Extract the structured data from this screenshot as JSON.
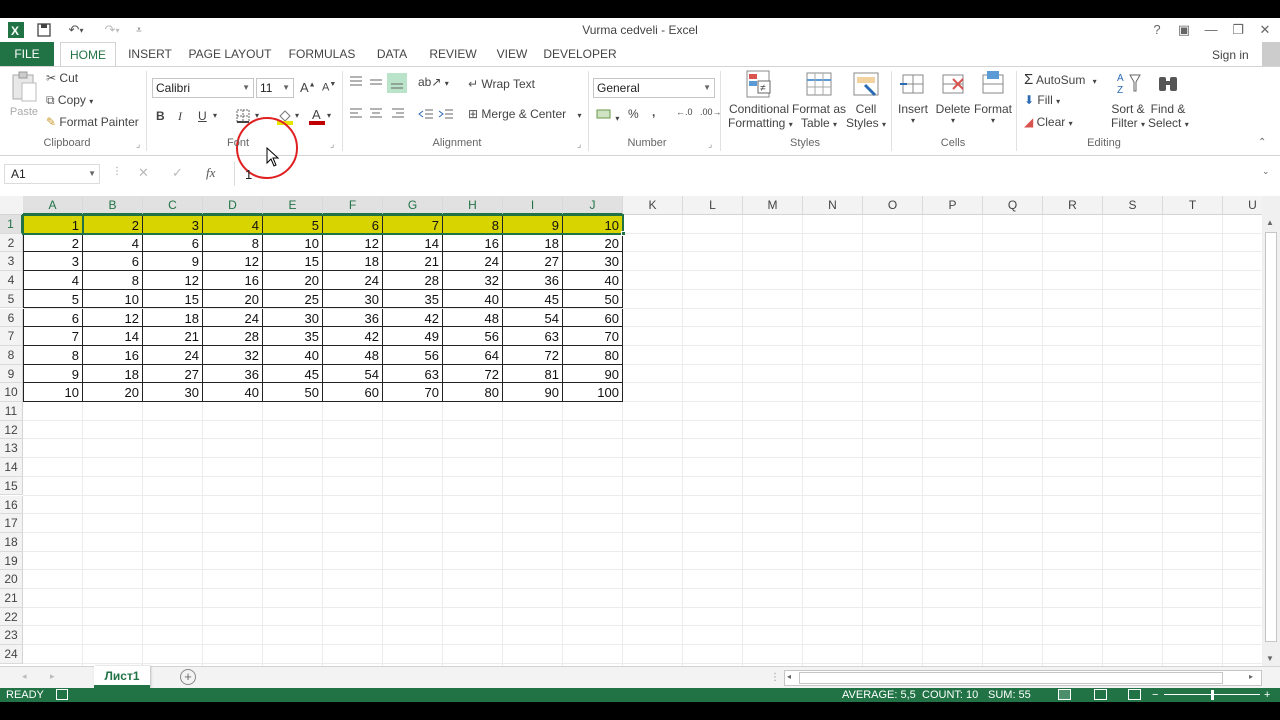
{
  "app": {
    "title": "Vurma cedveli - Excel",
    "accent": "#217346",
    "highlight": "#d8d400"
  },
  "title_controls": {
    "help": "?",
    "ribbon_opts": "▣",
    "minimize": "—",
    "restore": "❐",
    "close": "✕"
  },
  "account": {
    "sign_in": "Sign in"
  },
  "tabs": [
    "FILE",
    "HOME",
    "INSERT",
    "PAGE LAYOUT",
    "FORMULAS",
    "DATA",
    "REVIEW",
    "VIEW",
    "DEVELOPER"
  ],
  "ribbon": {
    "clipboard": {
      "paste": "Paste",
      "cut": "Cut",
      "copy": "Copy",
      "format_painter": "Format Painter",
      "label": "Clipboard"
    },
    "font": {
      "name": "Calibri",
      "size": "11",
      "bold": "B",
      "italic": "I",
      "underline": "U",
      "label": "Font"
    },
    "alignment": {
      "wrap_text": "Wrap Text",
      "merge_center": "Merge & Center",
      "label": "Alignment"
    },
    "number": {
      "format": "General",
      "percent": "%",
      "comma": ",",
      "label": "Number"
    },
    "styles": {
      "conditional_1": "Conditional",
      "conditional_2": "Formatting",
      "format_table_1": "Format as",
      "format_table_2": "Table",
      "cell_styles_1": "Cell",
      "cell_styles_2": "Styles",
      "label": "Styles"
    },
    "cells": {
      "insert": "Insert",
      "delete": "Delete",
      "format": "Format",
      "label": "Cells"
    },
    "editing": {
      "autosum": "AutoSum",
      "fill": "Fill",
      "clear": "Clear",
      "sort_1": "Sort &",
      "sort_2": "Filter",
      "find_1": "Find &",
      "find_2": "Select",
      "label": "Editing"
    }
  },
  "formula_bar": {
    "name_box": "A1",
    "fx": "fx",
    "value": "1"
  },
  "columns": [
    "A",
    "B",
    "C",
    "D",
    "E",
    "F",
    "G",
    "H",
    "I",
    "J",
    "K",
    "L",
    "M",
    "N",
    "O",
    "P",
    "Q",
    "R",
    "S",
    "T",
    "U"
  ],
  "rows": [
    "1",
    "2",
    "3",
    "4",
    "5",
    "6",
    "7",
    "8",
    "9",
    "10",
    "11",
    "12",
    "13",
    "14",
    "15",
    "16",
    "17",
    "18",
    "19",
    "20",
    "21",
    "22",
    "23",
    "24"
  ],
  "table": [
    [
      "1",
      "2",
      "3",
      "4",
      "5",
      "6",
      "7",
      "8",
      "9",
      "10"
    ],
    [
      "2",
      "4",
      "6",
      "8",
      "10",
      "12",
      "14",
      "16",
      "18",
      "20"
    ],
    [
      "3",
      "6",
      "9",
      "12",
      "15",
      "18",
      "21",
      "24",
      "27",
      "30"
    ],
    [
      "4",
      "8",
      "12",
      "16",
      "20",
      "24",
      "28",
      "32",
      "36",
      "40"
    ],
    [
      "5",
      "10",
      "15",
      "20",
      "25",
      "30",
      "35",
      "40",
      "45",
      "50"
    ],
    [
      "6",
      "12",
      "18",
      "24",
      "30",
      "36",
      "42",
      "48",
      "54",
      "60"
    ],
    [
      "7",
      "14",
      "21",
      "28",
      "35",
      "42",
      "49",
      "56",
      "63",
      "70"
    ],
    [
      "8",
      "16",
      "24",
      "32",
      "40",
      "48",
      "56",
      "64",
      "72",
      "80"
    ],
    [
      "9",
      "18",
      "27",
      "36",
      "45",
      "54",
      "63",
      "72",
      "81",
      "90"
    ],
    [
      "10",
      "20",
      "30",
      "40",
      "50",
      "60",
      "70",
      "80",
      "90",
      "100"
    ]
  ],
  "sheets": {
    "active": "Лист1"
  },
  "status": {
    "mode": "READY",
    "average": "AVERAGE: 5,5",
    "count": "COUNT: 10",
    "sum": "SUM: 55"
  }
}
